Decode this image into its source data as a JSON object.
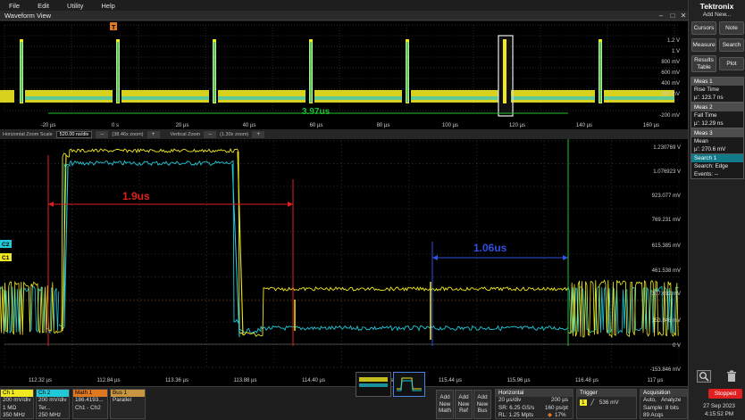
{
  "menu": [
    "File",
    "Edit",
    "Utility",
    "Help"
  ],
  "window": {
    "title": "Waveform View"
  },
  "colors": {
    "ch1": "#f0e820",
    "ch2": "#20c8d8",
    "math": "#e07820",
    "bus": "#c89640",
    "measure_red": "#e02020",
    "measure_blue": "#3050e0",
    "measure_green": "#20c030",
    "grid": "#4a4a4a"
  },
  "overview": {
    "y_labels": [
      "1.2 V",
      "1 V",
      "800 mV",
      "600 mV",
      "400 mV",
      "200 mV",
      "-200 mV"
    ],
    "x_labels": [
      "-20 µs",
      "0 s",
      "20 µs",
      "40 µs",
      "60 µs",
      "80 µs",
      "100 µs",
      "120 µs",
      "140 µs",
      "160 µs"
    ],
    "trigger_marker": "T",
    "span_label": "3.97us"
  },
  "zoom_strip": {
    "h_label": "Horizontal Zoom Scale",
    "h_value": "520.00 ns/div",
    "h_factor": "(38.46x zoom)",
    "v_label": "Vertical Zoom",
    "v_factor": "(1.30x zoom)",
    "minus": "–",
    "plus": "+"
  },
  "main_plot": {
    "y_labels": [
      "1.230769 V",
      "1.076923 V",
      "923.077 mV",
      "769.231 mV",
      "615.385 mV",
      "461.538 mV",
      "0 V",
      "-153.846 mV"
    ],
    "x_labels": [
      "112.32 µs",
      "112.84 µs",
      "113.36 µs",
      "113.88 µs",
      "114.40 µs",
      "114.92 µs",
      "115.44 µs",
      "115.96 µs",
      "116.48 µs",
      "117 µs"
    ],
    "annot_red": "1.9us",
    "annot_blue": "1.06us",
    "ch_markers": {
      "c2": "C2",
      "c1": "C1"
    },
    "mid_label_ch1": "307.692 mV",
    "mid_label_ch2": "153.846 mV"
  },
  "right_panel": {
    "logo": "Tektronix",
    "add_new": "Add New...",
    "buttons": {
      "cursors": "Cursors",
      "note": "Note",
      "measure": "Measure",
      "search": "Search",
      "results_1": "Results",
      "results_2": "Table",
      "plot": "Plot"
    },
    "meas1": {
      "title": "Meas 1",
      "name": "Rise Time",
      "value": "µ': 123.7 ns"
    },
    "meas2": {
      "title": "Meas 2",
      "name": "Fall Time",
      "value": "µ': 12.29 ns"
    },
    "meas3": {
      "title": "Meas 3",
      "name": "Mean",
      "value": "µ': 270.6 mV"
    },
    "search1": {
      "title": "Search 1",
      "line1": "Search: Edge",
      "line2": "Events: --"
    },
    "stop_label": "Stopped",
    "date": "27 Sep 2023",
    "time": "4:15:52 PM"
  },
  "bottom": {
    "ch1": {
      "title": "Ch 1",
      "l1": "200 mV/div",
      "l2": "1 MΩ",
      "l3": "350 MHz"
    },
    "ch2": {
      "title": "Ch 2",
      "l1": "200 mV/div",
      "l2": "Ter...",
      "l3": "250 MHz"
    },
    "math1": {
      "title": "Math 1",
      "l1": "186.4193...",
      "l2": "Ch1 - Ch2"
    },
    "bus1": {
      "title": "Bus 1",
      "l1": "Parallel"
    },
    "add_math": [
      "Add",
      "New",
      "Math"
    ],
    "add_ref": [
      "Add",
      "New",
      "Ref"
    ],
    "add_bus": [
      "Add",
      "New",
      "Bus"
    ],
    "horizontal": {
      "title": "Horizontal",
      "l1a": "20 µs/div",
      "l1b": "200 µs",
      "l2a": "SR: 6.25 GS/s",
      "l2b": "160 ps/pt",
      "l3a": "RL: 1.25 Mpts",
      "l3b": "17%"
    },
    "trigger": {
      "title": "Trigger",
      "ch": "1",
      "value": "536 mV"
    },
    "acquisition": {
      "title": "Acquisition",
      "l1a": "Auto,",
      "l1b": "Analyze",
      "l2a": "Sample: 8 bits",
      "l3a": "89 Acqs"
    }
  }
}
